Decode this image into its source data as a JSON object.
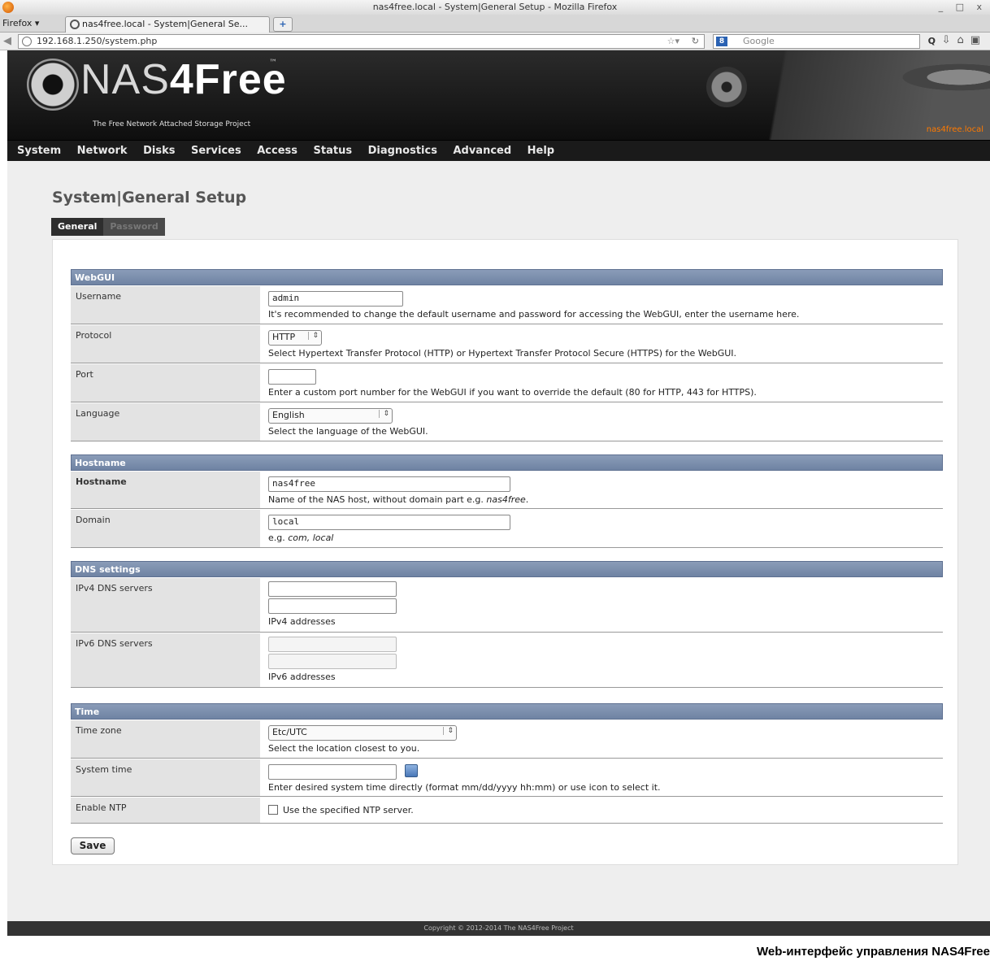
{
  "browser": {
    "window_title": "nas4free.local - System|General Setup - Mozilla Firefox",
    "window_controls": "_ □ x",
    "menu_label": "Firefox ▾",
    "tab_title": "nas4free.local - System|General Se...",
    "new_tab_symbol": "+",
    "url": "192.168.1.250/system.php",
    "search_placeholder": "Google",
    "search_engine_letter": "8"
  },
  "header": {
    "logo_main": "NAS",
    "logo_accent": "4Free",
    "logo_tm": "™",
    "tagline": "The Free Network Attached Storage Project",
    "host_label": "nas4free.local"
  },
  "nav": {
    "items": [
      "System",
      "Network",
      "Disks",
      "Services",
      "Access",
      "Status",
      "Diagnostics",
      "Advanced",
      "Help"
    ]
  },
  "page": {
    "title": "System|General Setup",
    "tabs": [
      {
        "label": "General",
        "active": true
      },
      {
        "label": "Password",
        "active": false
      }
    ]
  },
  "sections": {
    "webgui": {
      "title": "WebGUI",
      "username": {
        "label": "Username",
        "value": "admin",
        "hint": "It's recommended to change the default username and password for accessing the WebGUI, enter the username here."
      },
      "protocol": {
        "label": "Protocol",
        "value": "HTTP",
        "hint": "Select Hypertext Transfer Protocol (HTTP) or Hypertext Transfer Protocol Secure (HTTPS) for the WebGUI."
      },
      "port": {
        "label": "Port",
        "value": "",
        "hint": "Enter a custom port number for the WebGUI if you want to override the default (80 for HTTP, 443 for HTTPS)."
      },
      "language": {
        "label": "Language",
        "value": "English",
        "hint": "Select the language of the WebGUI."
      }
    },
    "hostname": {
      "title": "Hostname",
      "hostname": {
        "label": "Hostname",
        "value": "nas4free",
        "hint_prefix": "Name of the NAS host, without domain part e.g. ",
        "hint_example": "nas4free",
        "hint_suffix": "."
      },
      "domain": {
        "label": "Domain",
        "value": "local",
        "hint_prefix": "e.g. ",
        "hint_example": "com, local"
      }
    },
    "dns": {
      "title": "DNS settings",
      "ipv4": {
        "label": "IPv4 DNS servers",
        "value1": "",
        "value2": "",
        "hint": "IPv4 addresses"
      },
      "ipv6": {
        "label": "IPv6 DNS servers",
        "value1": "",
        "value2": "",
        "hint": "IPv6 addresses"
      }
    },
    "time": {
      "title": "Time",
      "timezone": {
        "label": "Time zone",
        "value": "Etc/UTC",
        "hint": "Select the location closest to you."
      },
      "system_time": {
        "label": "System time",
        "value": "",
        "hint": "Enter desired system time directly (format mm/dd/yyyy hh:mm) or use icon to select it."
      },
      "ntp": {
        "label": "Enable NTP",
        "checked": false,
        "checkbox_label": "Use the specified NTP server."
      }
    }
  },
  "actions": {
    "save_label": "Save"
  },
  "footer": {
    "copyright": "Copyright © 2012-2014 The NAS4Free Project"
  },
  "caption": "Web-интерфейс управления NAS4Free"
}
